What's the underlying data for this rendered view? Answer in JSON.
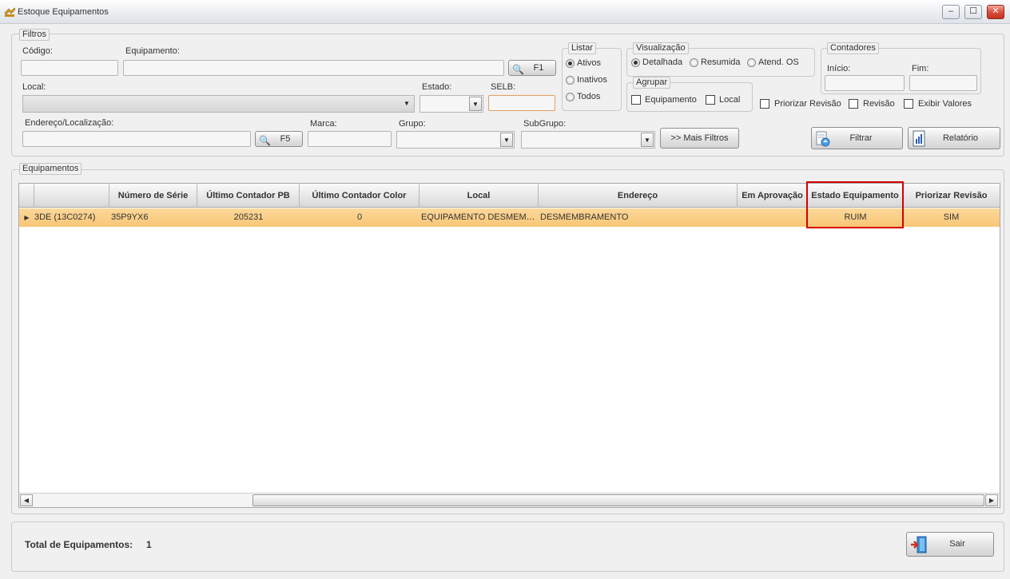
{
  "window": {
    "title": "Estoque Equipamentos",
    "minimize": "–",
    "maximize": "☐",
    "close": "✕"
  },
  "filtros": {
    "legend": "Filtros",
    "codigo_label": "Código:",
    "codigo_value": "",
    "equipamento_label": "Equipamento:",
    "equipamento_value": "",
    "f1_label": "F1",
    "local_label": "Local:",
    "estado_label": "Estado:",
    "selb_label": "SELB:",
    "endereco_label": "Endereço/Localização:",
    "f5_label": "F5",
    "marca_label": "Marca:",
    "grupo_label": "Grupo:",
    "subgrupo_label": "SubGrupo:",
    "mais_filtros_label": ">> Mais Filtros"
  },
  "listar": {
    "legend": "Listar",
    "ativos": "Ativos",
    "inativos": "Inativos",
    "todos": "Todos",
    "selected": "Ativos"
  },
  "visualizacao": {
    "legend": "Visualização",
    "detalhada": "Detalhada",
    "resumida": "Resumida",
    "atend_os": "Atend. OS",
    "selected": "Detalhada"
  },
  "agrupar": {
    "legend": "Agrupar",
    "equipamento": "Equipamento",
    "local": "Local"
  },
  "contadores": {
    "legend": "Contadores",
    "inicio_label": "Início:",
    "fim_label": "Fim:"
  },
  "options": {
    "priorizar_revisao": "Priorizar Revisão",
    "revisao": "Revisão",
    "exibir_valores": "Exibir Valores"
  },
  "actions": {
    "filtrar": "Filtrar",
    "relatorio": "Relatório",
    "sair": "Sair"
  },
  "equipamentos": {
    "legend": "Equipamentos",
    "columns": [
      "",
      "",
      "Número de Série",
      "Último Contador PB",
      "Último Contador Color",
      "Local",
      "Endereço",
      "Em Aprovação",
      "Estado Equipamento",
      "Priorizar Revisão"
    ],
    "rows": [
      {
        "indicator": "▶",
        "equipamento": "3DE (13C0274)",
        "numero_serie": "35P9YX6",
        "contador_pb": "205231",
        "contador_color": "0",
        "local": "EQUIPAMENTO  DESMEMBRAMENTO",
        "endereco": "DESMEMBRAMENTO",
        "em_aprovacao": "",
        "estado": "RUIM",
        "priorizar": "SIM"
      }
    ],
    "highlight_color": "#d40000",
    "selected_row_color": "#f8c676"
  },
  "footer": {
    "total_label": "Total de Equipamentos:",
    "total_value": "1"
  }
}
